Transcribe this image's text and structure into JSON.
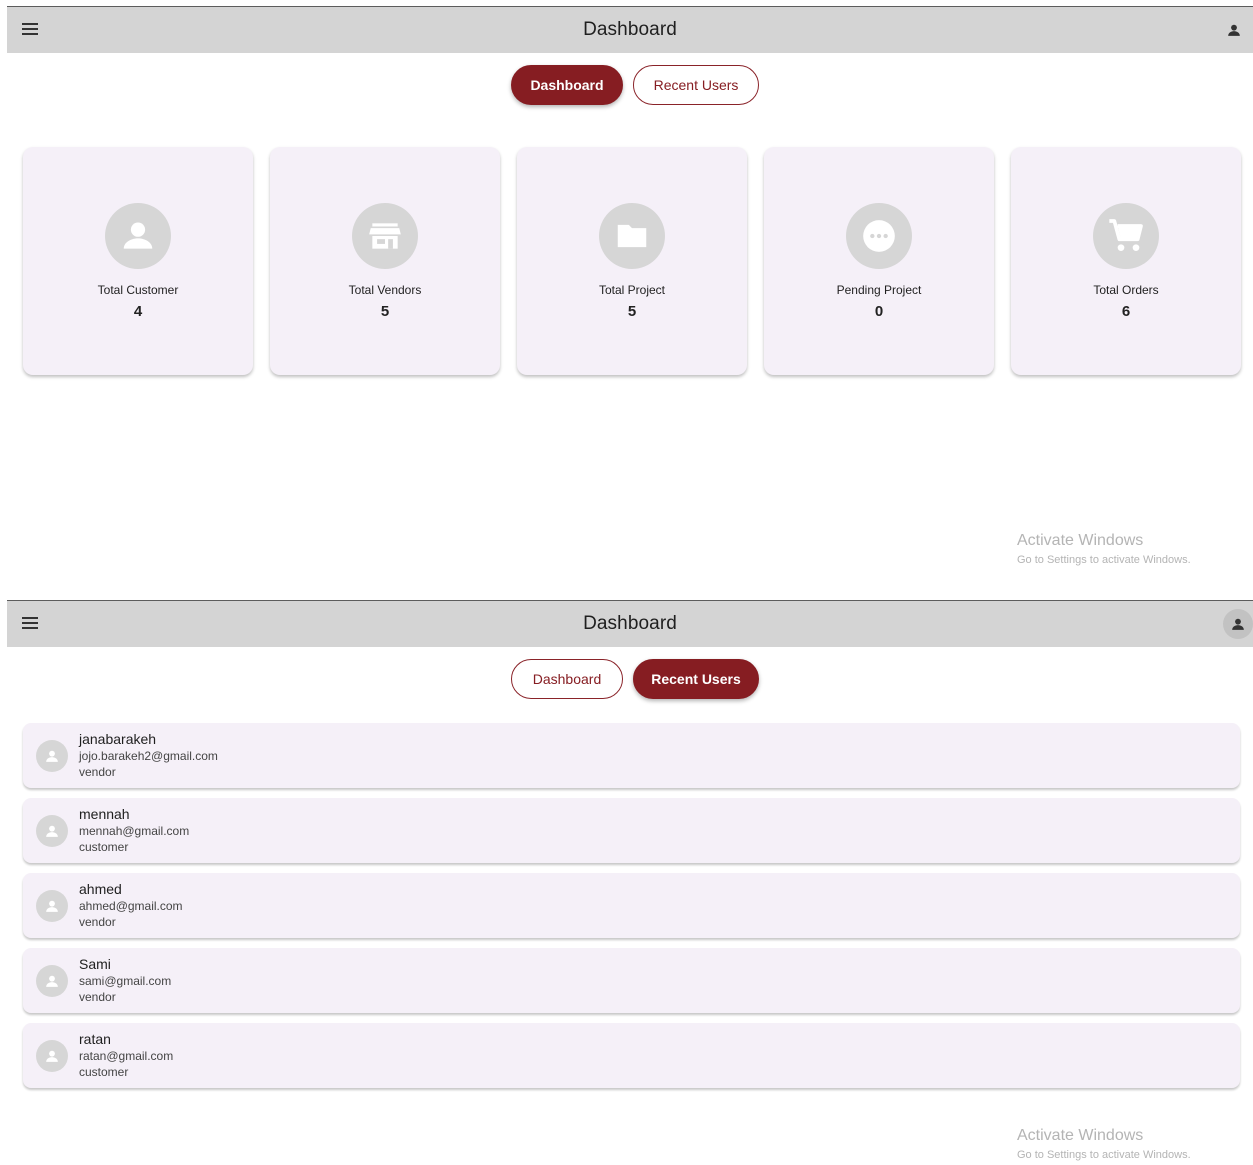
{
  "app_bar": {
    "title": "Dashboard"
  },
  "tabs": {
    "dashboard_label": "Dashboard",
    "recent_users_label": "Recent Users"
  },
  "stats": [
    {
      "label": "Total Customer",
      "value": "4",
      "icon": "person-icon"
    },
    {
      "label": "Total Vendors",
      "value": "5",
      "icon": "store-icon"
    },
    {
      "label": "Total Project",
      "value": "5",
      "icon": "folder-icon"
    },
    {
      "label": "Pending Project",
      "value": "0",
      "icon": "more-horizontal-icon"
    },
    {
      "label": "Total Orders",
      "value": "6",
      "icon": "shopping-cart-icon"
    }
  ],
  "recent_users": [
    {
      "name": "janabarakeh",
      "email": "jojo.barakeh2@gmail.com",
      "role": "vendor"
    },
    {
      "name": "mennah",
      "email": "mennah@gmail.com",
      "role": "customer"
    },
    {
      "name": "ahmed",
      "email": "ahmed@gmail.com",
      "role": "vendor"
    },
    {
      "name": "Sami",
      "email": "sami@gmail.com",
      "role": "vendor"
    },
    {
      "name": "ratan",
      "email": "ratan@gmail.com",
      "role": "customer"
    }
  ],
  "watermark": {
    "title": "Activate Windows",
    "subtitle": "Go to Settings to activate Windows."
  },
  "colors": {
    "accent": "#861d22",
    "app_bar": "#d4d4d4",
    "card_bg": "#f5f0f8",
    "icon_circle": "#d6d6d6"
  }
}
